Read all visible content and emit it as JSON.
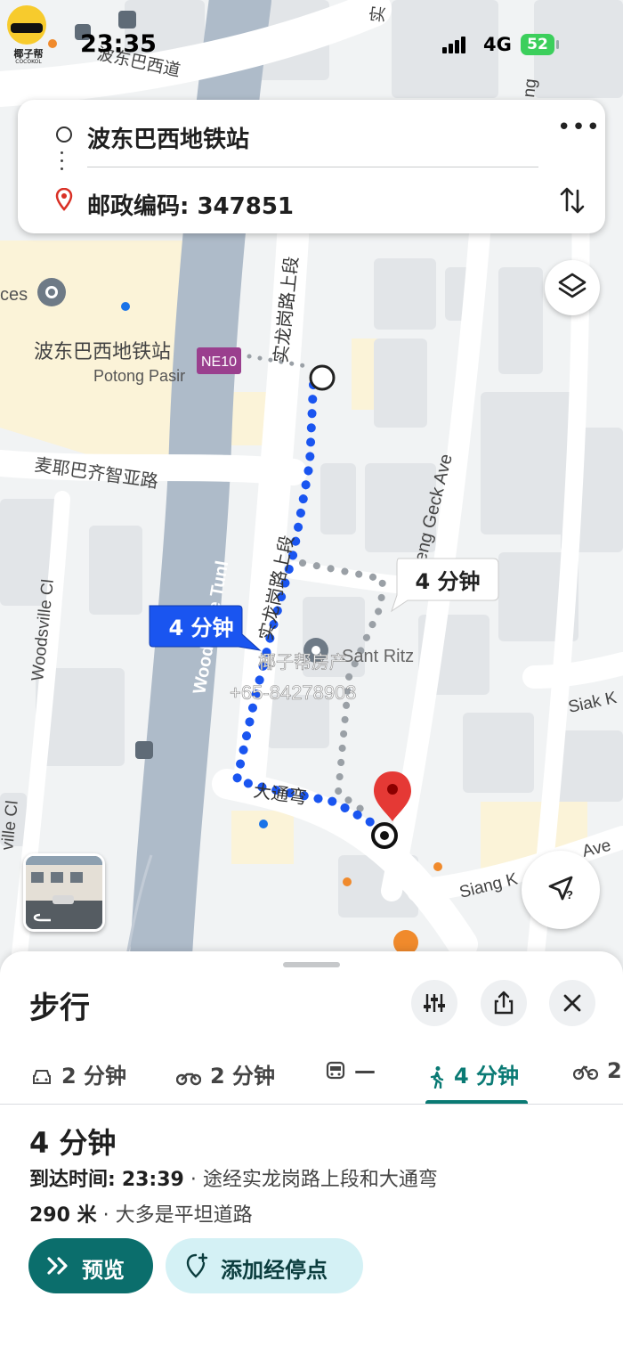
{
  "status_bar": {
    "time": "23:35",
    "network": "4G",
    "battery": "52"
  },
  "watermark_logo": {
    "name": "椰子帮",
    "sub": "COCOKOL"
  },
  "route": {
    "origin": "波东巴西地铁站",
    "destination": "邮政编码: 347851"
  },
  "map": {
    "station_cn": "波东巴西地铁站",
    "station_en": "Potong Pasir",
    "station_code": "NE10",
    "poi_left_partial": "ces",
    "road_macpherson": "麦耶巴齐智亚路",
    "road_upper_serangoon_top": "实龙岗路上段",
    "road_upper_serangoon_mid": "实龙岗路上段",
    "road_woodsville_tunl": "Woodsville Tunl",
    "road_woodsville_cl": "Woodsville Cl",
    "road_woodsville_cl_left": "ville Cl",
    "road_geck_ave": "eng Geck Ave",
    "road_siak": "Siak K",
    "road_siang": "Siang K",
    "road_ave": "Ave",
    "road_datong": "大通弯",
    "poi_ritz": "Sant Ritz",
    "road_top_left": "波东巴西道",
    "road_top_mid": "实",
    "road_top_right": "ng",
    "route_label_primary": "4 分钟",
    "route_label_alt": "4 分钟",
    "watermark_text": "椰子帮房产",
    "watermark_phone": "+65-84278903"
  },
  "panel": {
    "title": "步行",
    "modes": [
      {
        "icon": "car-icon",
        "label": "2 分钟"
      },
      {
        "icon": "motorbike-icon",
        "label": "2 分钟"
      },
      {
        "icon": "transit-icon",
        "label": "—"
      },
      {
        "icon": "walk-icon",
        "label": "4 分钟"
      },
      {
        "icon": "bike-icon",
        "label": "2"
      }
    ],
    "active_mode": "walk",
    "duration": "4 分钟",
    "arrival_label": "到达时间:",
    "arrival_time": "23:39",
    "via": "· 途经实龙岗路上段和大通弯",
    "distance": "290 米",
    "terrain": "· 大多是平坦道路",
    "preview_label": "预览",
    "add_stop_label": "添加经停点"
  },
  "colors": {
    "accent": "#0b6e6c",
    "route_blue": "#1a55f0",
    "pin_red": "#e53935"
  }
}
